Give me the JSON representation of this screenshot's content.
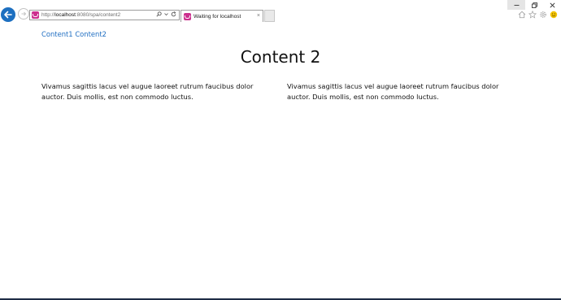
{
  "browser": {
    "url_host": "localhost",
    "url_prefix": "http://",
    "url_suffix": ":8080/spa/content2",
    "tab_title": "Waiting for localhost",
    "tab_close_glyph": "×"
  },
  "nav": {
    "links": [
      "Content1",
      "Content2"
    ]
  },
  "main": {
    "title": "Content 2",
    "paragraphs": [
      "Vivamus sagittis lacus vel augue laoreet rutrum faucibus dolor auctor. Duis mollis, est non commodo luctus.",
      "Vivamus sagittis lacus vel augue laoreet rutrum faucibus dolor auctor. Duis mollis, est non commodo luctus."
    ]
  },
  "icons": {
    "back": "back-arrow-icon",
    "forward": "forward-arrow-icon",
    "search": "search-icon",
    "refresh": "refresh-icon",
    "home": "home-icon",
    "favorites": "star-icon",
    "settings": "gear-icon",
    "feedback": "smiley-icon"
  },
  "colors": {
    "link": "#1f6ec2",
    "back_button": "#1c6fc0",
    "favicon": "#cc2f8e"
  }
}
